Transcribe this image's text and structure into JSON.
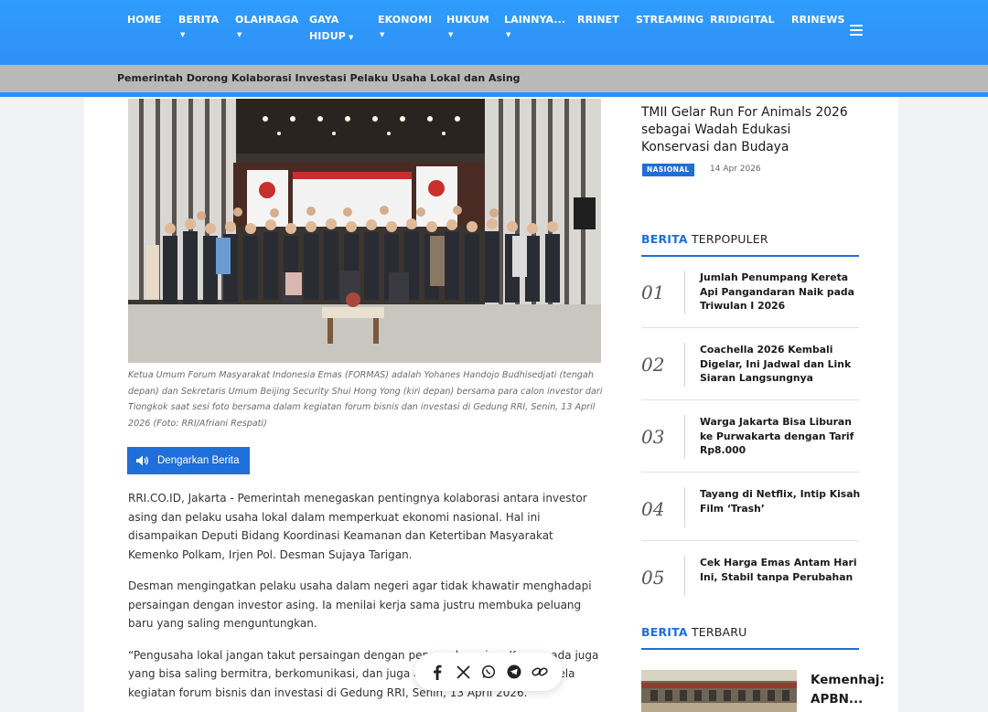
{
  "nav": {
    "items": [
      {
        "label": "HOME",
        "dropdown": false
      },
      {
        "label": "BERITA",
        "dropdown": true
      },
      {
        "label": "OLAHRAGA",
        "dropdown": true
      },
      {
        "label": "GAYA",
        "label2": "HIDUP",
        "dropdown": true
      },
      {
        "label": "EKONOMI",
        "dropdown": true
      },
      {
        "label": "HUKUM",
        "dropdown": true
      },
      {
        "label": "LAINNYA...",
        "dropdown": true
      },
      {
        "label": "RRINET",
        "dropdown": false
      },
      {
        "label": "STREAMING",
        "dropdown": false
      },
      {
        "label": "RRIDIGITAL",
        "dropdown": false
      },
      {
        "label": "RRINEWS",
        "dropdown": false
      }
    ],
    "menu_icon": "hamburger-icon"
  },
  "ticker": {
    "headline": "Pemerintah Dorong Kolaborasi Investasi Pelaku Usaha Lokal dan Asing"
  },
  "article": {
    "photo_caption": "Ketua Umum Forum Masyarakat Indonesia Emas (FORMAS) adalah Yohanes Handojo Budhisedjati (tengah depan) dan Sekretaris Umum Beijing Security Shui Hong Yong (kiri depan) bersama para calon investor dari Tiongkok saat sesi foto bersama dalam kegiatan forum bisnis dan investasi di Gedung RRI, Senin, 13 April 2026 (Foto: RRI/Afriani Respati)",
    "listen_label": "Dengarkan Berita",
    "paragraphs": [
      "RRI.CO.ID, Jakarta - Pemerintah menegaskan pentingnya kolaborasi antara investor asing dan pelaku usaha lokal dalam memperkuat ekonomi nasional. Hal ini disampaikan Deputi Bidang Koordinasi Keamanan dan Ketertiban Masyarakat Kemenko Polkam, Irjen Pol. Desman Sujaya Tarigan.",
      "Desman mengingatkan pelaku usaha dalam negeri agar tidak khawatir menghadapi persaingan dengan investor asing. Ia menilai kerja sama justru membuka peluang baru yang saling menguntungkan.",
      "“Pengusaha lokal jangan takut persaingan dengan pengusaha asing. Karena ada juga yang bisa saling bermitra, berkomunikasi, dan juga ada peluang,” ujarnya di sela kegiatan forum bisnis dan investasi di Gedung RRI, Senin, 13 April 2026."
    ],
    "share_icons": [
      "facebook-icon",
      "x-icon",
      "whatsapp-icon",
      "telegram-icon",
      "copy-link-icon"
    ]
  },
  "sidebar": {
    "top_story": {
      "title": "TMII Gelar Run For Animals 2026 sebagai Wadah Edukasi Konservasi dan Budaya",
      "tag": "NASIONAL",
      "date": "14 Apr 2026"
    },
    "popular": {
      "heading_accent": "BERITA",
      "heading_rest": " TERPOPULER",
      "items": [
        {
          "num": "01",
          "title": "Jumlah Penumpang Kereta Api Pangandaran Naik pada Triwulan I 2026"
        },
        {
          "num": "02",
          "title": "Coachella 2026 Kembali Digelar, Ini Jadwal dan Link Siaran Langsungnya"
        },
        {
          "num": "03",
          "title": "Warga Jakarta Bisa Liburan ke Purwakarta dengan Tarif Rp8.000"
        },
        {
          "num": "04",
          "title": "Tayang di Netflix, Intip Kisah Film ‘Trash’"
        },
        {
          "num": "05",
          "title": "Cek Harga Emas Antam Hari Ini, Stabil tanpa Perubahan"
        }
      ]
    },
    "latest": {
      "heading_accent": "BERITA",
      "heading_rest": " TERBARU",
      "first_title_line1": "Kemenhaj:",
      "first_title_line2": "APBN..."
    }
  },
  "colors": {
    "nav_blue": "#2e9dfc",
    "accent_blue": "#1e6fd9",
    "ticker_gray": "#b9b9b9"
  }
}
